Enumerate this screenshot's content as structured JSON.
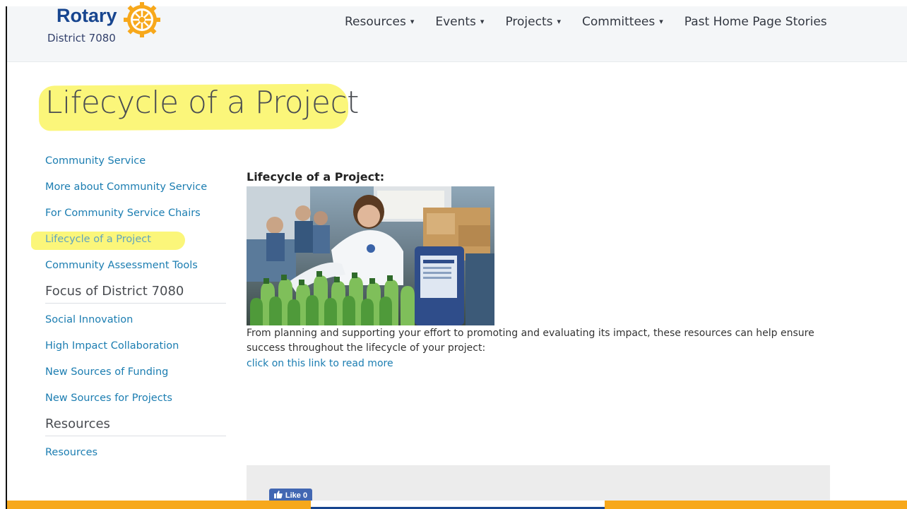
{
  "header": {
    "logo": {
      "name": "Rotary",
      "subtitle": "District 7080",
      "icon": "rotary-wheel-icon",
      "brand_color": "#17458f",
      "wheel_color": "#f7a81b"
    },
    "nav": [
      {
        "label": "Resources",
        "dropdown": true
      },
      {
        "label": "Events",
        "dropdown": true
      },
      {
        "label": "Projects",
        "dropdown": true
      },
      {
        "label": "Committees",
        "dropdown": true
      },
      {
        "label": "Past Home Page Stories",
        "dropdown": false
      }
    ],
    "caret": "▾"
  },
  "page": {
    "title": "Lifecycle of a Project",
    "highlight_color": "#fbf67a"
  },
  "sidebar": {
    "links": [
      {
        "label": "Community Service"
      },
      {
        "label": "More about Community Service"
      },
      {
        "label": "For Community Service Chairs"
      },
      {
        "label": "Lifecycle of a Project",
        "active": true
      },
      {
        "label": "Community Assessment Tools"
      }
    ],
    "focus_heading": "Focus of District 7080",
    "focus_links": [
      {
        "label": "Social Innovation"
      },
      {
        "label": "High Impact Collaboration"
      },
      {
        "label": "New Sources of Funding"
      },
      {
        "label": "New Sources for Projects"
      }
    ],
    "resources_heading": "Resources",
    "resources_links": [
      {
        "label": "Resources"
      }
    ]
  },
  "content": {
    "heading": "Lifecycle of a Project:",
    "image_alt": "volunteers packing supplies",
    "text": "From planning and supporting your effort to promoting and evaluating its impact, these resources can help ensure success throughout the lifecycle of your project:",
    "link": "click on this link to read more"
  },
  "social": {
    "like_label": "Like 0",
    "like_icon": "thumbs-up-icon",
    "like_color": "#4267b2"
  },
  "colors": {
    "link": "#1b7db1",
    "bottom_bar": [
      "#f7a81b",
      "#17458f",
      "#f7a81b"
    ]
  }
}
